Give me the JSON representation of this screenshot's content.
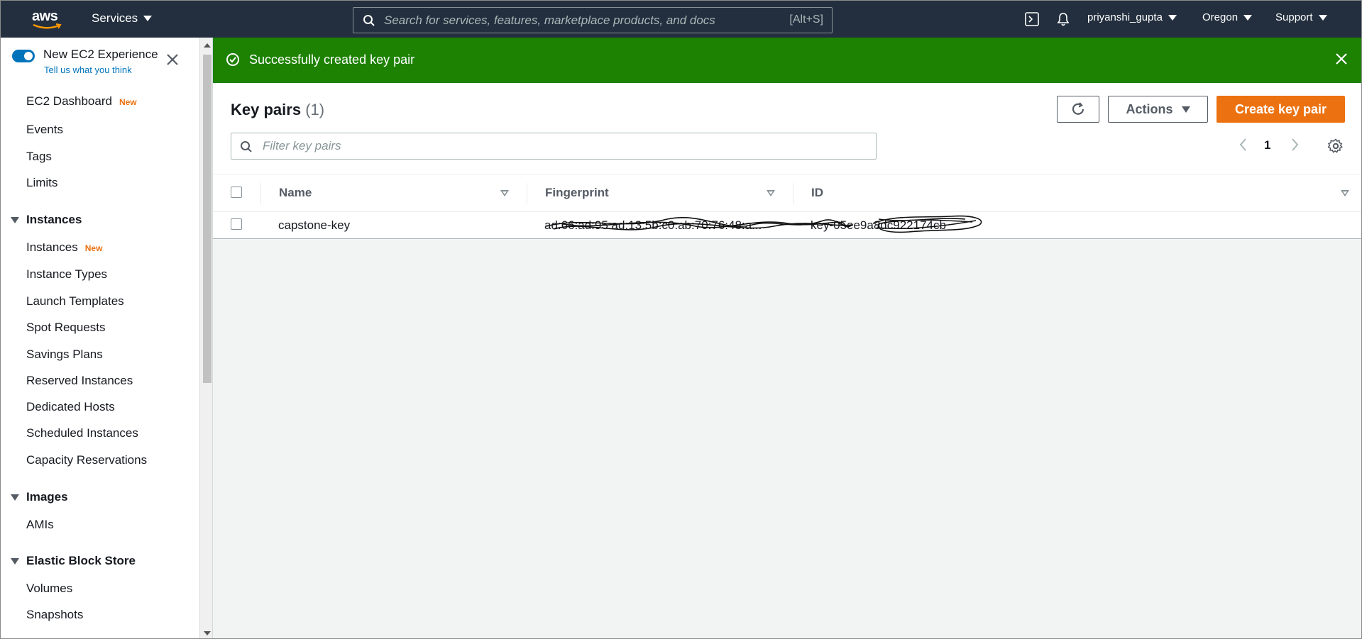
{
  "topnav": {
    "logo": "aws",
    "services_label": "Services",
    "search_placeholder": "Search for services, features, marketplace products, and docs",
    "search_shortcut": "[Alt+S]",
    "username": "priyanshi_gupta",
    "region": "Oregon",
    "support": "Support",
    "icons": [
      "cloudshell-icon",
      "bell-icon"
    ]
  },
  "sidebar": {
    "experience_title": "New EC2 Experience",
    "experience_link": "Tell us what you think",
    "items": [
      {
        "label": "EC2 Dashboard",
        "badge": "New"
      },
      {
        "label": "Events",
        "badge": ""
      },
      {
        "label": "Tags",
        "badge": ""
      },
      {
        "label": "Limits",
        "badge": ""
      }
    ],
    "sections": [
      {
        "title": "Instances",
        "items": [
          {
            "label": "Instances",
            "badge": "New"
          },
          {
            "label": "Instance Types",
            "badge": ""
          },
          {
            "label": "Launch Templates",
            "badge": ""
          },
          {
            "label": "Spot Requests",
            "badge": ""
          },
          {
            "label": "Savings Plans",
            "badge": ""
          },
          {
            "label": "Reserved Instances",
            "badge": ""
          },
          {
            "label": "Dedicated Hosts",
            "badge": ""
          },
          {
            "label": "Scheduled Instances",
            "badge": ""
          },
          {
            "label": "Capacity Reservations",
            "badge": ""
          }
        ]
      },
      {
        "title": "Images",
        "items": [
          {
            "label": "AMIs",
            "badge": ""
          }
        ]
      },
      {
        "title": "Elastic Block Store",
        "items": [
          {
            "label": "Volumes",
            "badge": ""
          },
          {
            "label": "Snapshots",
            "badge": ""
          }
        ]
      }
    ]
  },
  "flash": {
    "message": "Successfully created key pair",
    "status_color": "#1d8102"
  },
  "main": {
    "title": "Key pairs",
    "count": "(1)",
    "actions_label": "Actions",
    "create_label": "Create key pair",
    "filter_placeholder": "Filter key pairs",
    "page": "1",
    "columns": [
      "Name",
      "Fingerprint",
      "ID"
    ],
    "rows": [
      {
        "name": "capstone-key",
        "fingerprint": "ad:66:ad:95:ad:13:5b:c0:ab:70:76:48:a...",
        "id": "key-05ee9a8dc922174cb"
      }
    ]
  },
  "colors": {
    "nav_bg": "#232f3e",
    "accent": "#ec7211",
    "link": "#0073bb"
  }
}
